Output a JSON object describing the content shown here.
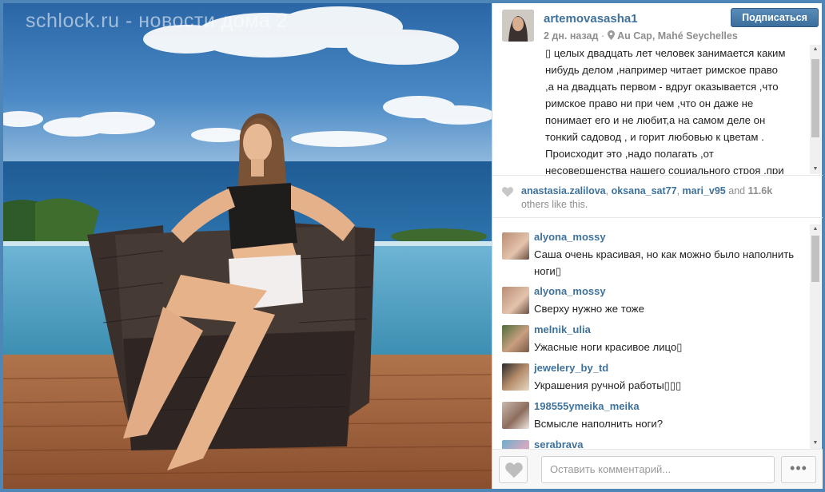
{
  "photo": {
    "watermark": "schlock.ru - новости дома 2"
  },
  "post": {
    "username": "artemovasasha1",
    "time_ago": "2 дн. назад",
    "location": "Au Cap, Mahé Seychelles",
    "follow_label": "Подписаться",
    "caption_lines": [
      "▯ целых двадцать лет человек занимается каким",
      "нибудь делом ,например читает римское право",
      ",а на двадцать первом - вдруг оказывается ,что",
      "римское право ни при чем ,что он даже не",
      "понимает его и не любит,а на самом деле он",
      "тонкий садовод , и горит любовью к цветам .",
      "Происходит это ,надо полагать ,от",
      "несовершенства нашего социального строя ,при"
    ]
  },
  "likes": {
    "users": [
      "anastasia.zalilova",
      "oksana_sat77",
      "mari_v95"
    ],
    "and_word": "and",
    "count": "11.6k",
    "others_text": "others like this."
  },
  "comments": [
    {
      "user": "alyona_mossy",
      "text": "Саша очень красивая, но как можно было наполнить ноги▯"
    },
    {
      "user": "alyona_mossy",
      "text": "Сверху нужно же тоже"
    },
    {
      "user": "melnik_ulia",
      "text": "Ужасные ноги красивое лицо▯"
    },
    {
      "user": "jewelery_by_td",
      "text": "Украшения ручной работы▯▯▯"
    },
    {
      "user": "198555ymeika_meika",
      "text": "Всмысле наполнить ноги?"
    },
    {
      "user": "serabrava",
      "text": ""
    }
  ],
  "footer": {
    "comment_placeholder": "Оставить комментарий...",
    "more_label": "•••"
  },
  "icons": {
    "location": "map-pin-icon",
    "heart": "heart-icon",
    "more": "ellipsis-icon"
  },
  "colors": {
    "username": "#3f729b",
    "follow_button": "#4a7eab",
    "text": "#222222",
    "muted": "#8e8e8e"
  }
}
